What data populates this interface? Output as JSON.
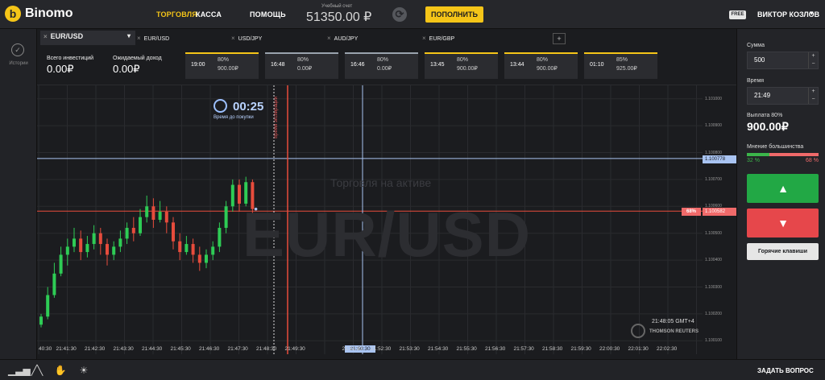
{
  "header": {
    "logo_mark": "b",
    "logo": "Binomo",
    "nav": {
      "trade": "ТОРГОВЛЯ",
      "cash": "КАССА",
      "help": "ПОМОЩЬ"
    },
    "account_label": "Учебный счет",
    "balance": "51350.00 ₽",
    "deposit": "ПОПОЛНИТЬ",
    "free_badge": "FREE",
    "username": "ВИКТОР КОЗЛОВ",
    "user_chevron": "▾"
  },
  "sidebar": {
    "history_label": "Истории",
    "history_icon": "✓"
  },
  "tabs": [
    {
      "x": "×",
      "label": "EUR/USD"
    },
    {
      "x": "×",
      "label": "EUR/USD"
    },
    {
      "x": "×",
      "label": "USD/JPY"
    },
    {
      "x": "×",
      "label": "AUD/JPY"
    },
    {
      "x": "×",
      "label": "EUR/GBP"
    }
  ],
  "tab_active_chevron": "▾",
  "tab_add": "+",
  "info": {
    "total_invest_label": "Всего инвестиций",
    "total_invest": "0.00₽",
    "expected_income_label": "Ожидаемый доход",
    "expected_income": "0.00₽"
  },
  "deals": [
    {
      "time": "19:00",
      "pct": "80%",
      "amount": "900.00₽"
    },
    {
      "time": "16:48",
      "pct": "80%",
      "amount": "0.00₽"
    },
    {
      "time": "16:46",
      "pct": "80%",
      "amount": "0.00₽"
    },
    {
      "time": "13:45",
      "pct": "80%",
      "amount": "900.00₽"
    },
    {
      "time": "13:44",
      "pct": "80%",
      "amount": "900.00₽"
    },
    {
      "time": "01:10",
      "pct": "85%",
      "amount": "925.00₽"
    }
  ],
  "chart": {
    "watermark": "EUR/USD",
    "watermark_sub": "Торговля на активе",
    "timer": "00:25",
    "timer_label": "Время до покупки",
    "expiry_label": "Время экспирации",
    "clock": "21:48:05 GMT+4",
    "reuters": "THOMSON REUTERS",
    "price_blue": "1.100778",
    "price_red": "1.100582",
    "pct_tag": "68%",
    "yticks": [
      "1.101000",
      "1.100900",
      "1.100800",
      "1.100700",
      "1.100600",
      "1.100500",
      "1.100400",
      "1.100300",
      "1.100200",
      "1.100100"
    ],
    "xticks": [
      "40:30",
      "21:41:30",
      "21:42:30",
      "21:43:30",
      "21:44:30",
      "21:45:30",
      "21:46:30",
      "21:47:30",
      "21:48:30",
      "21:49:30",
      "21:50:30",
      "21:51:30",
      "21:52:30",
      "21:53:30",
      "21:54:30",
      "21:55:30",
      "21:56:30",
      "21:57:30",
      "21:58:30",
      "21:59:30",
      "22:00:30",
      "22:01:30",
      "22:02:30"
    ],
    "x_highlight": "21:50:30",
    "colors": {
      "up": "#2ecc55",
      "down": "#e74c3c",
      "expiry": "#e74c3c",
      "current": "#a9c4f2"
    }
  },
  "chart_data": {
    "type": "candlestick",
    "series": [
      {
        "o": 1.10016,
        "c": 1.10019,
        "h": 1.1002,
        "l": 1.10015
      },
      {
        "o": 1.10019,
        "c": 1.10027,
        "h": 1.1003,
        "l": 1.10018
      },
      {
        "o": 1.10027,
        "c": 1.10035,
        "h": 1.10039,
        "l": 1.10026
      },
      {
        "o": 1.10035,
        "c": 1.10042,
        "h": 1.10045,
        "l": 1.10034
      },
      {
        "o": 1.10042,
        "c": 1.10045,
        "h": 1.10048,
        "l": 1.10038
      },
      {
        "o": 1.10045,
        "c": 1.10048,
        "h": 1.10052,
        "l": 1.10043
      },
      {
        "o": 1.10048,
        "c": 1.10043,
        "h": 1.10051,
        "l": 1.1004
      },
      {
        "o": 1.10043,
        "c": 1.10046,
        "h": 1.10049,
        "l": 1.10041
      },
      {
        "o": 1.10046,
        "c": 1.1005,
        "h": 1.10053,
        "l": 1.10044
      },
      {
        "o": 1.1005,
        "c": 1.10046,
        "h": 1.10052,
        "l": 1.10042
      },
      {
        "o": 1.10046,
        "c": 1.10042,
        "h": 1.10048,
        "l": 1.10038
      },
      {
        "o": 1.10042,
        "c": 1.10045,
        "h": 1.10047,
        "l": 1.1004
      },
      {
        "o": 1.10045,
        "c": 1.10048,
        "h": 1.10051,
        "l": 1.10043
      },
      {
        "o": 1.10048,
        "c": 1.10052,
        "h": 1.10054,
        "l": 1.10046
      },
      {
        "o": 1.10052,
        "c": 1.1005,
        "h": 1.10056,
        "l": 1.10047
      },
      {
        "o": 1.1005,
        "c": 1.10056,
        "h": 1.10059,
        "l": 1.10049
      },
      {
        "o": 1.10056,
        "c": 1.1006,
        "h": 1.10064,
        "l": 1.10054
      },
      {
        "o": 1.1006,
        "c": 1.10055,
        "h": 1.10063,
        "l": 1.10052
      },
      {
        "o": 1.10055,
        "c": 1.10058,
        "h": 1.10062,
        "l": 1.10054
      },
      {
        "o": 1.10058,
        "c": 1.10054,
        "h": 1.1006,
        "l": 1.1005
      },
      {
        "o": 1.10054,
        "c": 1.10047,
        "h": 1.10056,
        "l": 1.10044
      },
      {
        "o": 1.10047,
        "c": 1.10043,
        "h": 1.1005,
        "l": 1.1004
      },
      {
        "o": 1.10043,
        "c": 1.10046,
        "h": 1.10049,
        "l": 1.10042
      },
      {
        "o": 1.10046,
        "c": 1.10042,
        "h": 1.10048,
        "l": 1.10039
      },
      {
        "o": 1.10042,
        "c": 1.10039,
        "h": 1.10045,
        "l": 1.10036
      },
      {
        "o": 1.10039,
        "c": 1.10042,
        "h": 1.10044,
        "l": 1.10037
      },
      {
        "o": 1.10042,
        "c": 1.10045,
        "h": 1.10047,
        "l": 1.1004
      },
      {
        "o": 1.10045,
        "c": 1.10052,
        "h": 1.10054,
        "l": 1.10043
      },
      {
        "o": 1.10052,
        "c": 1.1006,
        "h": 1.10062,
        "l": 1.1005
      },
      {
        "o": 1.1006,
        "c": 1.10068,
        "h": 1.1007,
        "l": 1.10058
      },
      {
        "o": 1.10068,
        "c": 1.10061,
        "h": 1.1007,
        "l": 1.10058
      },
      {
        "o": 1.10061,
        "c": 1.10069,
        "h": 1.10071,
        "l": 1.1006
      },
      {
        "o": 1.10069,
        "c": 1.10059,
        "h": 1.1007,
        "l": 1.10057
      }
    ],
    "ylim": [
      1.10005,
      1.10105
    ]
  },
  "bottombar": {
    "ask": "ЗАДАТЬ ВОПРОС",
    "icons": [
      "▁▃▅",
      "╱╲",
      "✋",
      "☀"
    ]
  },
  "panel": {
    "sum_label": "Сумма",
    "sum": "500",
    "time_label": "Время",
    "time": "21:49",
    "stepper": "+\n−",
    "payout_label": "Выплата 80%",
    "payout": "900.00₽",
    "majority_label": "Мнение большинства",
    "majority_up": "32 %",
    "majority_down": "68 %",
    "majority_up_fraction": 0.32,
    "up_icon": "▲",
    "down_icon": "▼",
    "hotkeys": "Горячие клавиши"
  }
}
